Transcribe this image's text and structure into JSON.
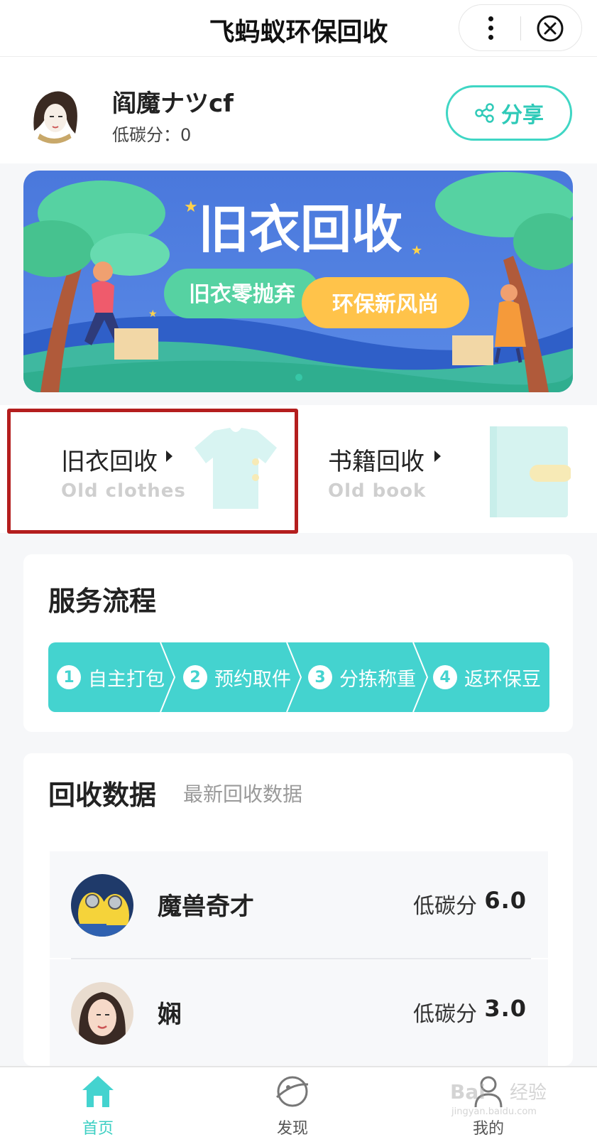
{
  "app": {
    "title": "飞蚂蚁环保回收"
  },
  "profile": {
    "username": "阎魔ナツcf",
    "score_label": "低碳分：",
    "score_value": "0",
    "share_label": "分享"
  },
  "banner": {
    "headline": "旧衣回收",
    "slogan_left": "旧衣零抛弃",
    "slogan_right": "环保新风尚"
  },
  "categories": [
    {
      "name": "旧衣回收",
      "subtitle": "Old clothes"
    },
    {
      "name": "书籍回收",
      "subtitle": "Old book"
    }
  ],
  "service_flow": {
    "title": "服务流程",
    "steps": [
      {
        "num": "1",
        "label": "自主打包"
      },
      {
        "num": "2",
        "label": "预约取件"
      },
      {
        "num": "3",
        "label": "分拣称重"
      },
      {
        "num": "4",
        "label": "返环保豆"
      }
    ]
  },
  "recycle_data": {
    "title": "回收数据",
    "subtitle": "最新回收数据",
    "rows": [
      {
        "name": "魔兽奇才",
        "label": "低碳分",
        "value": "6.0"
      },
      {
        "name": "娴",
        "label": "低碳分",
        "value": "3.0"
      }
    ]
  },
  "tabbar": {
    "tabs": [
      {
        "label": "首页",
        "icon": "home-icon",
        "active": true
      },
      {
        "label": "发现",
        "icon": "planet-icon",
        "active": false
      },
      {
        "label": "我的",
        "icon": "user-icon",
        "active": false
      }
    ]
  },
  "watermark": {
    "brand": "Bai",
    "brand_suffix": "经验",
    "url": "jingyan.baidu.com"
  },
  "colors": {
    "accent": "#3fd6c4",
    "flow_bg": "#44d3cf",
    "highlight": "#b41e1e"
  }
}
